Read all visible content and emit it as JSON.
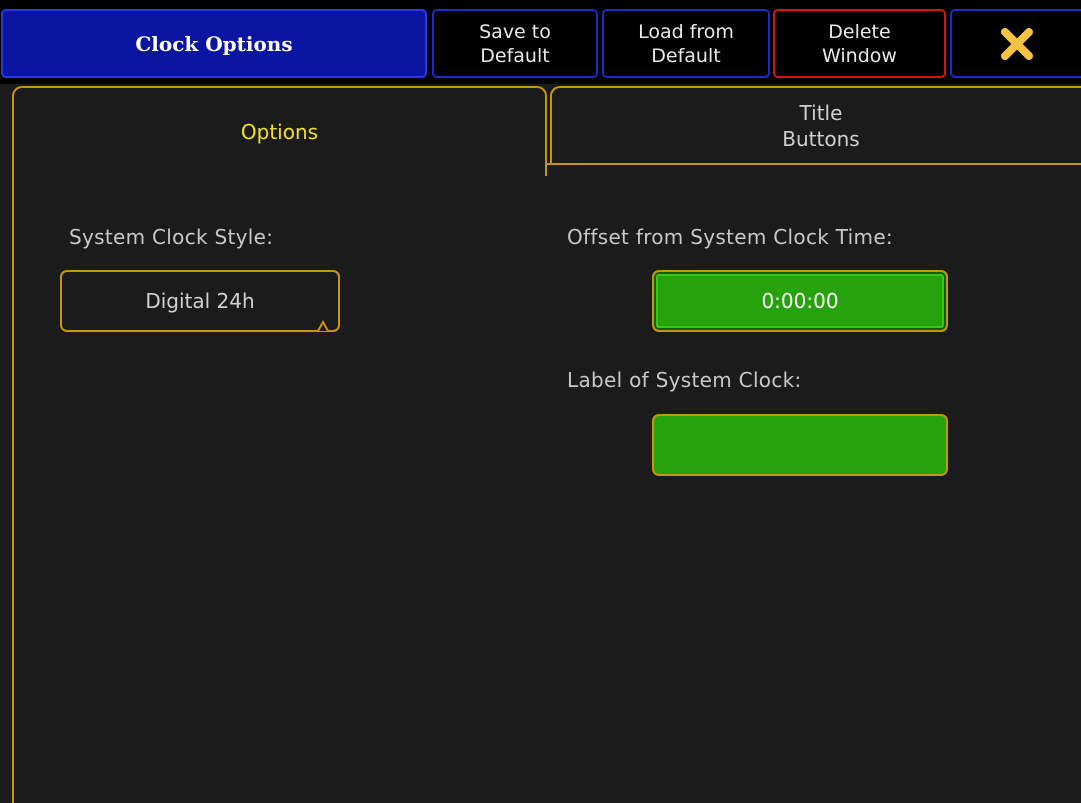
{
  "titlebar": {
    "title": "Clock Options",
    "save_label": "Save to\nDefault",
    "load_label": "Load from\nDefault",
    "delete_label": "Delete\nWindow",
    "close_icon": "close-x-icon"
  },
  "tabs": [
    {
      "label": "Options",
      "active": true
    },
    {
      "label": "Title\nButtons",
      "active": false
    }
  ],
  "options": {
    "clock_style_label": "System Clock Style:",
    "clock_style_value": "Digital 24h",
    "offset_label": "Offset from System Clock Time:",
    "offset_value": "0:00:00",
    "clock_label_label": "Label of System Clock:",
    "clock_label_value": ""
  },
  "colors": {
    "accent": "#c8960c",
    "active_tab_text": "#f2e020",
    "title_bg": "#0a16a2",
    "delete_border": "#d61414",
    "field_green": "#26a30c",
    "close_icon": "#f5c242"
  }
}
